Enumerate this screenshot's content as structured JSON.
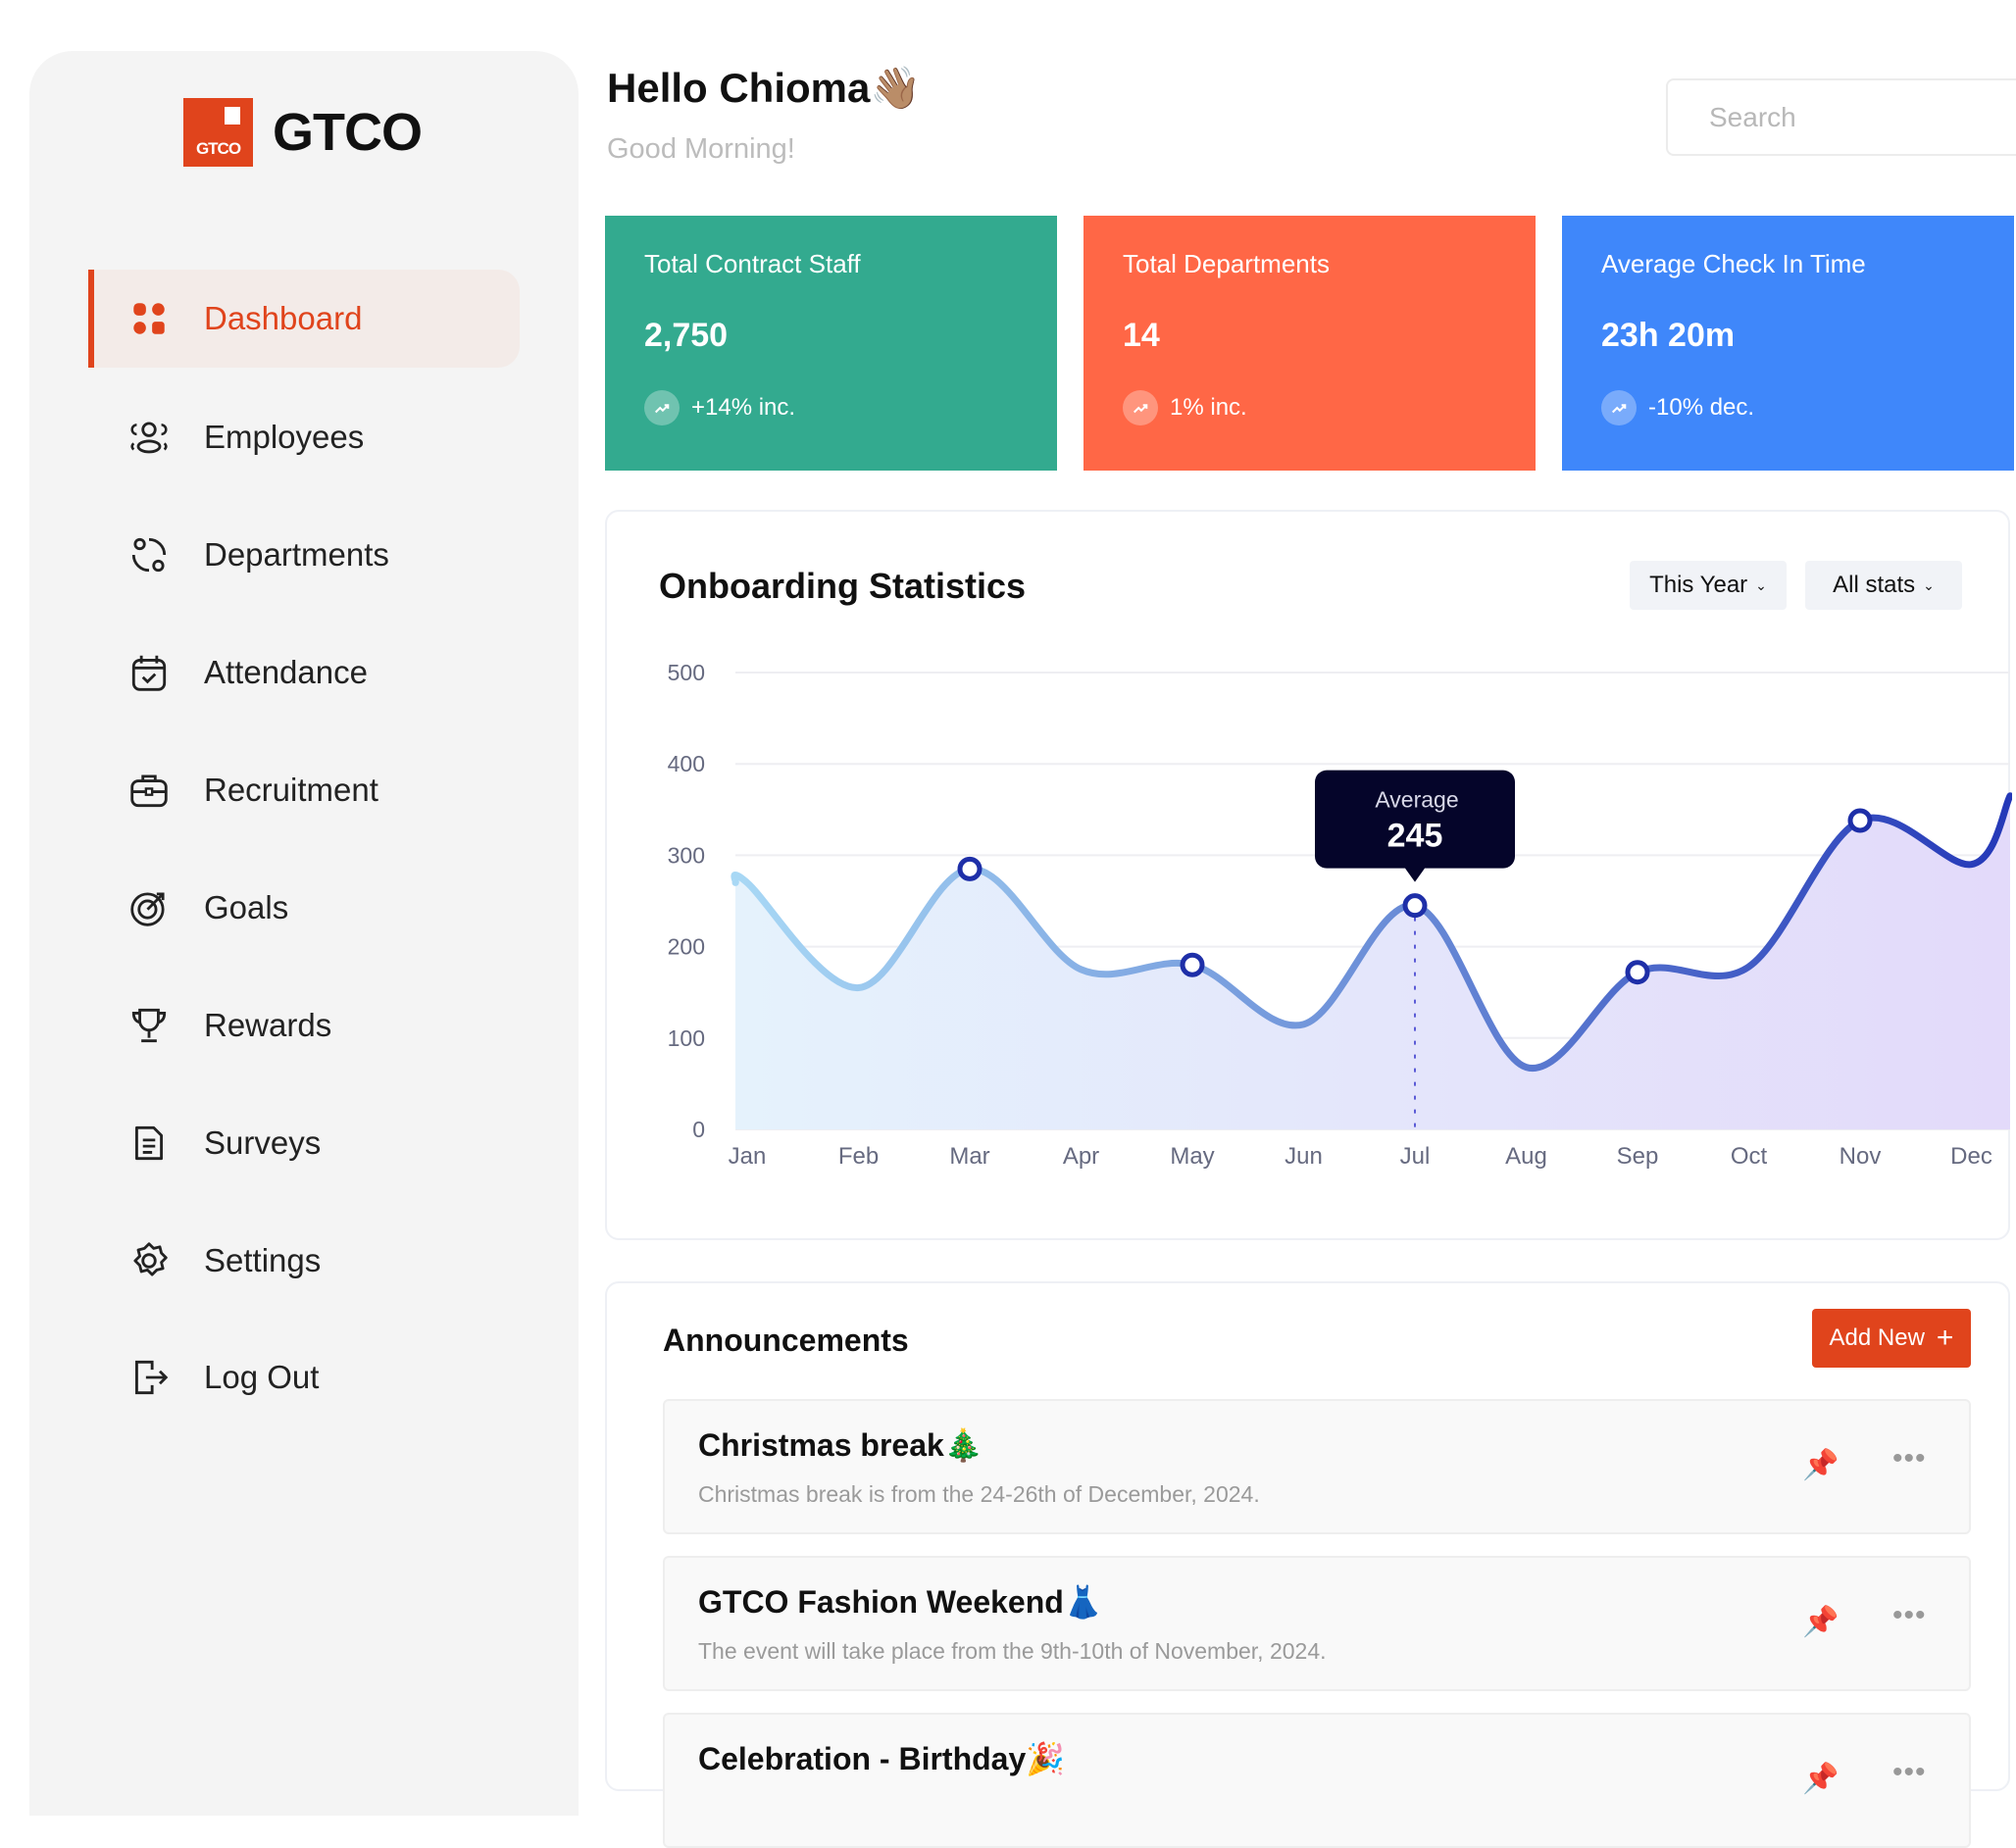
{
  "brand": {
    "name": "GTCO",
    "logo_text": "GTCO",
    "color": "#e0441c"
  },
  "sidebar": {
    "items": [
      {
        "label": "Dashboard",
        "icon": "dashboard-grid-icon",
        "active": true
      },
      {
        "label": "Employees",
        "icon": "users-icon"
      },
      {
        "label": "Departments",
        "icon": "departments-icon"
      },
      {
        "label": "Attendance",
        "icon": "calendar-check-icon"
      },
      {
        "label": "Recruitment",
        "icon": "briefcase-icon"
      },
      {
        "label": "Goals",
        "icon": "target-icon"
      },
      {
        "label": "Rewards",
        "icon": "trophy-icon"
      },
      {
        "label": "Surveys",
        "icon": "document-icon"
      },
      {
        "label": "Settings",
        "icon": "gear-icon"
      },
      {
        "label": "Log Out",
        "icon": "logout-icon"
      }
    ]
  },
  "header": {
    "greeting": "Hello Chioma👋🏽",
    "subtitle": "Good Morning!",
    "search_placeholder": "Search"
  },
  "stats": [
    {
      "title": "Total Contract Staff",
      "value": "2,750",
      "trend": "+14% inc.",
      "color": "#33aa8f"
    },
    {
      "title": "Total Departments",
      "value": "14",
      "trend": "1% inc.",
      "color": "#ff6746"
    },
    {
      "title": "Average Check In Time",
      "value": "23h 20m",
      "trend": "-10% dec.",
      "color": "#3f87fa"
    }
  ],
  "chart_panel": {
    "title": "Onboarding Statistics",
    "filter_period": "This Year",
    "filter_stats": "All stats"
  },
  "chart_data": {
    "type": "area",
    "categories": [
      "Jan",
      "Feb",
      "Mar",
      "Apr",
      "May",
      "Jun",
      "Jul",
      "Aug",
      "Sep",
      "Oct",
      "Nov",
      "Dec"
    ],
    "values": [
      270,
      155,
      285,
      175,
      180,
      115,
      245,
      68,
      172,
      178,
      338,
      290
    ],
    "highlighted": [
      "Mar",
      "May",
      "Jul",
      "Sep",
      "Nov"
    ],
    "yticks": [
      0,
      100,
      200,
      300,
      400,
      500
    ],
    "ylim": [
      0,
      500
    ],
    "grid": true,
    "tooltip": {
      "category": "Jul",
      "label": "Average",
      "value": "245"
    }
  },
  "announcements": {
    "title": "Announcements",
    "add_label": "Add New",
    "items": [
      {
        "title": "Christmas break🎄",
        "description": "Christmas break is from the 24-26th of December, 2024."
      },
      {
        "title": "GTCO Fashion Weekend👗",
        "description": "The event will take place from the 9th-10th of November, 2024."
      },
      {
        "title": "Celebration - Birthday🎉",
        "description": ""
      }
    ]
  }
}
